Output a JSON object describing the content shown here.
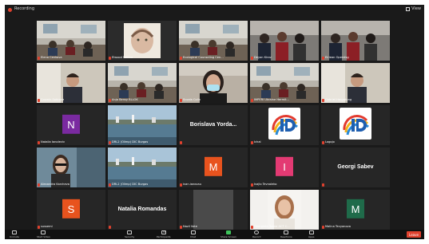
{
  "window": {
    "recording_label": "Recording",
    "view_label": "View"
  },
  "tiles": [
    {
      "name": "Elena Cenkova",
      "kind": "video",
      "scene": "room"
    },
    {
      "name": "Elwood Pelitna",
      "kind": "video",
      "scene": "art"
    },
    {
      "name": "Ecological Counseling Cen...",
      "kind": "video",
      "scene": "room"
    },
    {
      "name": "Deyan Kirov",
      "kind": "video",
      "scene": "people"
    },
    {
      "name": "Eiriean Opendsg",
      "kind": "video",
      "scene": "people"
    },
    {
      "name": "Cosmin Sohtone",
      "kind": "video",
      "scene": "person"
    },
    {
      "name": "Anja Bensy BLLOK",
      "kind": "video",
      "scene": "room"
    },
    {
      "name": "Scoala Colin",
      "kind": "video",
      "scene": "masked"
    },
    {
      "name": "IMPERI Ukraine Hermit...",
      "kind": "video",
      "scene": "room"
    },
    {
      "name": "Gabriel Hargatung",
      "kind": "video",
      "scene": "person"
    },
    {
      "name": "Natalia Ianoleviv",
      "kind": "avatar",
      "letter": "N",
      "color": "#7a2aa0"
    },
    {
      "name": "DRL2 (Olimp) DIC Burgas",
      "kind": "video",
      "scene": "harbor"
    },
    {
      "name": "Borislava Yorda...",
      "kind": "bigname"
    },
    {
      "name": "Ichal",
      "kind": "logo"
    },
    {
      "name": "Logojo",
      "kind": "logo"
    },
    {
      "name": "Alexandra Karcheva",
      "kind": "video",
      "scene": "woman"
    },
    {
      "name": "DRL2 (Olimp) DIC Burgas",
      "kind": "video",
      "scene": "harbor"
    },
    {
      "name": "ivan.ianovau",
      "kind": "avatar",
      "letter": "M",
      "color": "#e8531e"
    },
    {
      "name": "Ivajlo Tevnaleko",
      "kind": "avatar",
      "letter": "I",
      "color": "#e33a73"
    },
    {
      "name": "Georgi Sabev",
      "kind": "bigname"
    },
    {
      "name": "sussemi",
      "kind": "avatar",
      "letter": "S",
      "color": "#e8531e"
    },
    {
      "name": "Natalia Romandas",
      "kind": "bigname"
    },
    {
      "name": "Nazil Vote",
      "kind": "video",
      "scene": "blank"
    },
    {
      "name": "Georgieta Toane ACT C...",
      "kind": "video",
      "scene": "woman2"
    },
    {
      "name": "Malina Tevyanova",
      "kind": "avatar",
      "letter": "M",
      "color": "#1f6b4a"
    }
  ],
  "toolbar": {
    "items": [
      {
        "label": "Unmute",
        "icon": "mic-icon"
      },
      {
        "label": "Start Video",
        "icon": "camera-icon"
      },
      {
        "label": "Security",
        "icon": "shield-icon"
      },
      {
        "label": "Participants",
        "icon": "participants-icon",
        "count": "55"
      },
      {
        "label": "Chat",
        "icon": "chat-icon"
      },
      {
        "label": "Share Screen",
        "icon": "share-screen-icon"
      },
      {
        "label": "Record",
        "icon": "record-icon"
      },
      {
        "label": "Reactions",
        "icon": "reactions-icon"
      },
      {
        "label": "Apps",
        "icon": "apps-icon"
      }
    ],
    "leave_label": "Leave"
  }
}
